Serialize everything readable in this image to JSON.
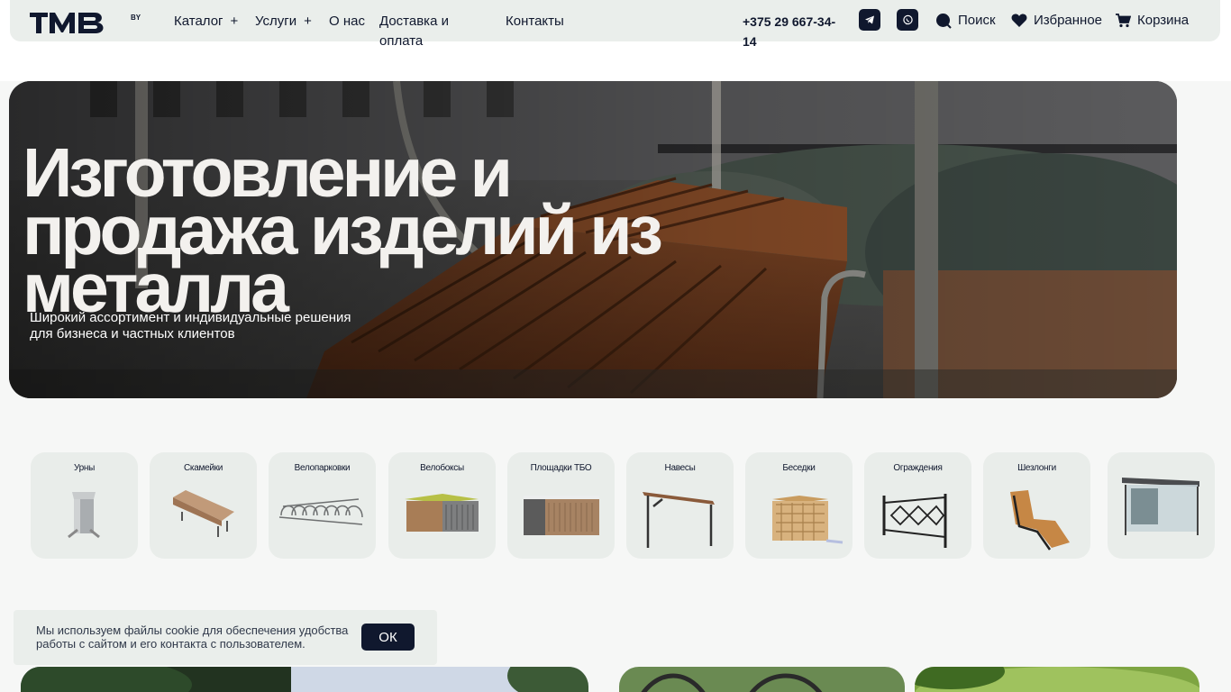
{
  "header": {
    "logo_text": "TMB",
    "logo_suffix": "BY",
    "nav": [
      {
        "label": "Каталог",
        "plus": "+"
      },
      {
        "label": "Услуги",
        "plus": "+"
      },
      {
        "label": "О нас"
      },
      {
        "label": "Доставка и оплата"
      },
      {
        "label": "Контакты"
      }
    ],
    "phone": "+375 29 667-34-14",
    "search_label": "Поиск",
    "favorites_label": "Избранное",
    "cart_label": "Корзина",
    "icons": [
      "telegram-icon",
      "viber-icon",
      "search-icon",
      "heart-icon",
      "cart-icon"
    ]
  },
  "hero": {
    "title": "Изготовление и продажа изделий из металла",
    "subtitle": "Широкий ассортимент и индивидуальные решения для бизнеса и частных клиентов"
  },
  "categories": [
    {
      "label": "Урны"
    },
    {
      "label": "Скамейки"
    },
    {
      "label": "Велопарковки"
    },
    {
      "label": "Велобоксы"
    },
    {
      "label": "Площадки ТБО"
    },
    {
      "label": "Навесы"
    },
    {
      "label": "Беседки"
    },
    {
      "label": "Ограждения"
    },
    {
      "label": "Шезлонги"
    },
    {
      "label": ""
    }
  ],
  "cookie": {
    "text": "Мы используем файлы cookie для обеспечения удобства работы с сайтом и его контакта с пользователем.",
    "button_label": "ОК"
  },
  "colors": {
    "primary": "#10182e",
    "header_bg": "#eaeeeb",
    "page_bg": "#f6f7f6",
    "card_bg": "#e9edea"
  }
}
